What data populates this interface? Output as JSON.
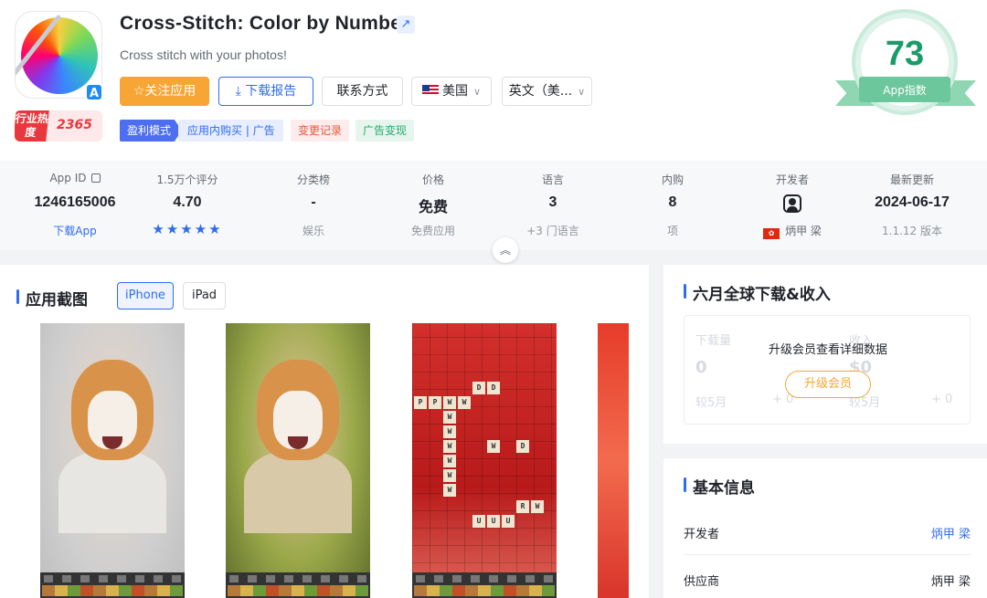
{
  "app": {
    "title": "Cross-Stitch: Color by Number",
    "subtitle": "Cross stitch with your photos!",
    "hot_label": "行业热度",
    "hot_value": "2365",
    "ext_link_icon": "↗",
    "appstore_icon": "A"
  },
  "actions": {
    "follow": "☆关注应用",
    "report": "⤓ 下载报告",
    "contact": "联系方式",
    "country": "美国",
    "language": "英文（美..."
  },
  "tags": {
    "monetization": "盈利模式",
    "monetization_detail": "应用内购买 | 广告",
    "changelog": "变更记录",
    "ad_monetization": "广告变现"
  },
  "score": {
    "value": "73",
    "label": "App指数",
    "color": "#1a9b6a"
  },
  "stats": [
    {
      "key": "App ID",
      "value": "1246165006",
      "sub": "下载App"
    },
    {
      "key": "1.5万个评分",
      "value": "4.70",
      "stars": "★★★★★"
    },
    {
      "key": "分类榜",
      "value": "-",
      "sub": "娱乐"
    },
    {
      "key": "价格",
      "value": "免费",
      "sub": "免费应用"
    },
    {
      "key": "语言",
      "value": "3",
      "sub": "+3 门语言"
    },
    {
      "key": "内购",
      "value": "8",
      "sub": "项"
    },
    {
      "key": "开发者",
      "sub": "炳甲 梁"
    },
    {
      "key": "最新更新",
      "value": "2024-06-17",
      "sub": "1.1.12 版本"
    }
  ],
  "collapse_icon": "︽",
  "screenshots": {
    "title": "应用截图",
    "tab_iphone": "iPhone",
    "tab_ipad": "iPad",
    "tiles_a": [
      "D",
      "D"
    ],
    "tiles_b": [
      "P",
      "P",
      "W",
      "W"
    ],
    "tiles_c": [
      "W",
      "W",
      "W",
      "W",
      "W",
      "W"
    ],
    "tiles_d": [
      "W",
      "D"
    ],
    "tiles_e": [
      "U",
      "U",
      "U",
      "R",
      "W"
    ]
  },
  "downloads": {
    "title": "六月全球下载&收入",
    "message": "升级会员查看详细数据",
    "upgrade": "升级会员",
    "ghost_dl": "下载量",
    "ghost_rev": "收入",
    "ghost_zero": "0",
    "ghost_dollar": "$0",
    "ghost_prev": "较5月",
    "ghost_pct": "+ 0"
  },
  "basic": {
    "title": "基本信息",
    "developer_label": "开发者",
    "developer_value": "炳甲 梁",
    "seller_label": "供应商",
    "seller_value": "炳甲 梁"
  }
}
